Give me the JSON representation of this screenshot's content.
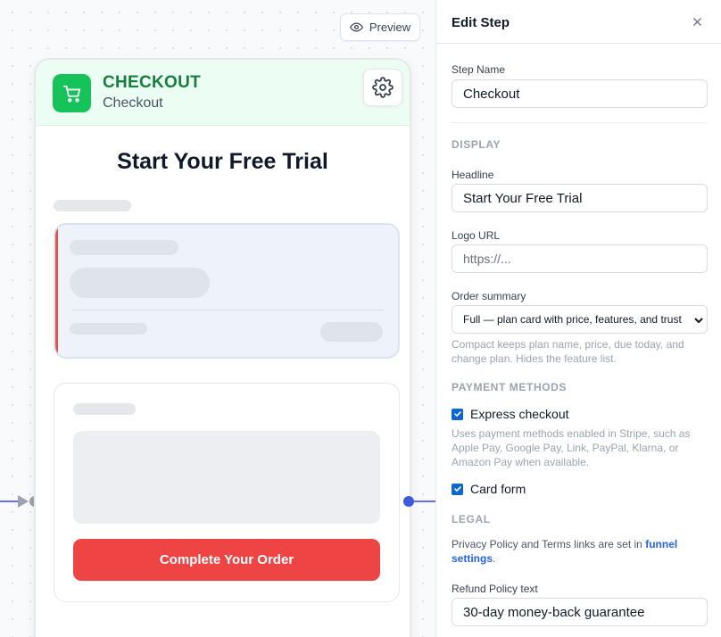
{
  "toolbar": {
    "preview_label": "Preview"
  },
  "node": {
    "type_label": "CHECKOUT",
    "name": "Checkout",
    "headline": "Start Your Free Trial",
    "cta_label": "Complete Your Order",
    "icon": "cart-icon",
    "settings_icon": "gear-icon"
  },
  "panel": {
    "title": "Edit Step",
    "step_name_label": "Step Name",
    "step_name_value": "Checkout",
    "display_section": "DISPLAY",
    "headline_label": "Headline",
    "headline_value": "Start Your Free Trial",
    "logo_label": "Logo URL",
    "logo_placeholder": "https://...",
    "order_summary_label": "Order summary",
    "order_summary_value": "Full — plan card with price, features, and trust",
    "order_summary_help": "Compact keeps plan name, price, due today, and change plan. Hides the feature list.",
    "payment_section": "PAYMENT METHODS",
    "express_label": "Express checkout",
    "express_checked": true,
    "express_help": "Uses payment methods enabled in Stripe, such as Apple Pay, Google Pay, Link, PayPal, Klarna, or Amazon Pay when available.",
    "card_form_label": "Card form",
    "card_form_checked": true,
    "legal_section": "LEGAL",
    "legal_text_before": "Privacy Policy and Terms links are set in ",
    "legal_link": "funnel settings",
    "legal_text_after": ".",
    "refund_label": "Refund Policy text",
    "refund_value": "30-day money-back guarantee"
  },
  "colors": {
    "accent_green": "#16c25a",
    "cta_red": "#ef4444",
    "checkbox_blue": "#0b67d0",
    "link_blue": "#2563eb",
    "edge_purple": "#6a6cf0"
  }
}
